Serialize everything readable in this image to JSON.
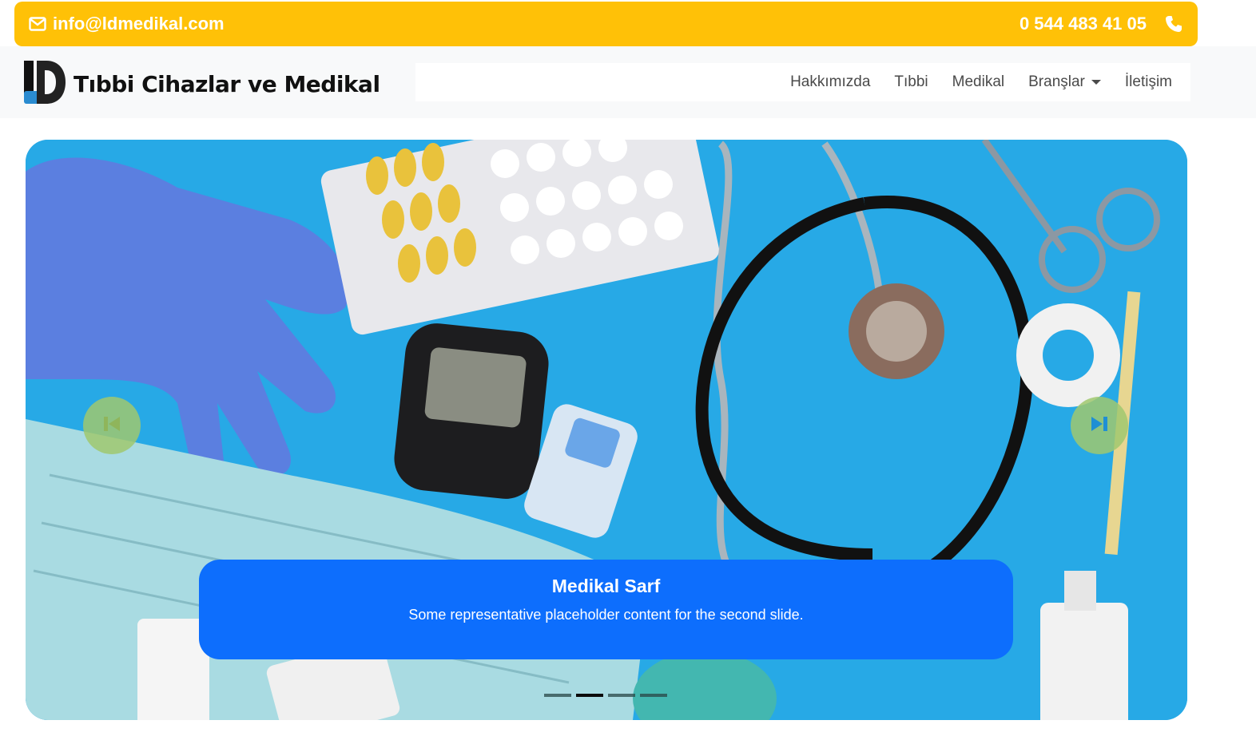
{
  "topbar": {
    "email": "info@ldmedikal.com",
    "email_icon": "envelope-icon",
    "phone": "0 544 483 41 05",
    "phone_icon": "phone-icon",
    "bg_color": "#ffc107"
  },
  "brand": {
    "logo_text": "LD",
    "logo_icon": "ld-logo-icon",
    "name": "Tıbbi Cihazlar ve Medikal"
  },
  "nav": {
    "items": [
      {
        "label": "Hakkımızda"
      },
      {
        "label": "Tıbbi"
      },
      {
        "label": "Medikal"
      },
      {
        "label": "Branşlar"
      },
      {
        "label": "İletişim"
      }
    ]
  },
  "carousel": {
    "caption_title": "Medikal Sarf",
    "caption_text": "Some representative placeholder content for the second slide.",
    "caption_bg": "#0d6efd",
    "prev_icon": "skip-back-icon",
    "next_icon": "skip-forward-icon",
    "indicator_count": 4,
    "active_indicator": 2
  }
}
